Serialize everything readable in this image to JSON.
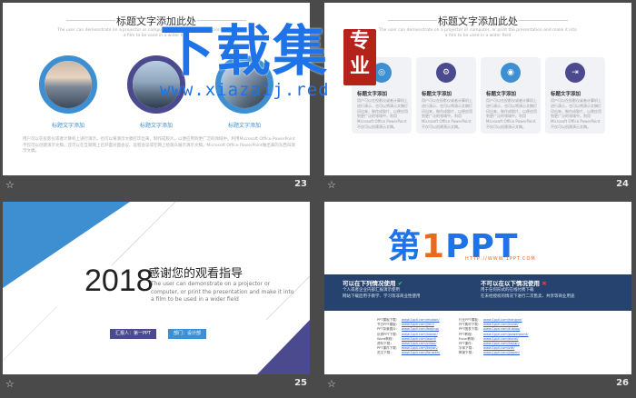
{
  "slides": [
    {
      "number": "23",
      "title": "标题文字添加此处",
      "subtitle": "The user can demonstrate on a projector or computer, or print the presentation and make it into a film to be used in a wider field",
      "captions": [
        "标题文字添加",
        "标题文字添加",
        "标题文字添加"
      ],
      "paragraph": "用户可以在投影仪或者计算机上进行演示，也可以将演示文稿打印出来，制作成胶片，以便应用到更广泛的领域中。利用Microsoft Office PowerPoint不仅可以创建演示文稿，还可以在互联网上召开面对面会议、远程会议或在网上给观众展示演示文稿。Microsoft Office PowerPoint做出来的东西叫演示文稿。"
    },
    {
      "number": "24",
      "title": "标题文字添加此处",
      "subtitle": "The user can demonstrate on a projector or computer, or print the presentation and make it into a film to be used in a wider field",
      "cards": [
        {
          "icon": "◎",
          "title": "标题文字添加",
          "body": "用户可以在投影仪或者计算机上进行演示，也可以将演示文稿打印出来，制作成胶片，以便应用到更广泛的领域中。利用Microsoft Office PowerPoint不仅可以创建演示文稿。"
        },
        {
          "icon": "⚙",
          "title": "标题文字添加",
          "body": "用户可以在投影仪或者计算机上进行演示，也可以将演示文稿打印出来，制作成胶片，以便应用到更广泛的领域中。利用Microsoft Office PowerPoint不仅可以创建演示文稿。"
        },
        {
          "icon": "◉",
          "title": "标题文字添加",
          "body": "用户可以在投影仪或者计算机上进行演示，也可以将演示文稿打印出来，制作成胶片，以便应用到更广泛的领域中。利用Microsoft Office PowerPoint不仅可以创建演示文稿。"
        },
        {
          "icon": "⇥",
          "title": "标题文字添加",
          "body": "用户可以在投影仪或者计算机上进行演示，也可以将演示文稿打印出来，制作成胶片，以便应用到更广泛的领域中。利用Microsoft Office PowerPoint不仅可以创建演示文稿。"
        }
      ]
    },
    {
      "number": "25",
      "year": "2018",
      "thanks": "感谢您的观看指导",
      "body": "The user can demonstrate on a projector or computer, or print the presentation and make it into a film to be used in a wider field",
      "pill_left": "汇报人：第一PPT",
      "pill_right": "部门：设计部"
    },
    {
      "number": "26",
      "logo_main": "第",
      "logo_one": "1",
      "logo_ppt": "PPT",
      "logo_url": "HTTP://WWW.1PPT.COM",
      "can_use_title": "可以在下列情况使用",
      "can_use_items": [
        "个人或者企业内部汇报演示使用",
        "网站下载后用于教学、学习等非商业性使用"
      ],
      "cannot_use_title": "不可以在以下情况使用",
      "cannot_use_items": [
        "用于任何形式的在线付费下载",
        "在未经授权的情况下进行二次售卖、共享等商业用途"
      ],
      "left_labels": [
        "PPT模板下载：",
        "节日PPT模板：",
        "PPT背景图片：",
        "优秀PPT下载：",
        "Word教程：",
        "资料下载：",
        "PPT课件下载：",
        "范文下载："
      ],
      "left_links": [
        "www.1ppt.com/moban/",
        "www.1ppt.com/jieri/",
        "www.1ppt.com/beijing/",
        "www.1ppt.com/xiazai/",
        "www.1ppt.com/word/",
        "www.1ppt.com/ziliao/",
        "www.1ppt.com/kejian/",
        "www.1ppt.com/fanwen/"
      ],
      "right_labels": [
        "行业PPT模板：",
        "PPT素材下载：",
        "PPT图表下载：",
        "PPT教程：",
        "Excel教程：",
        "PPT课件：",
        "字体下载：",
        "教案下载："
      ],
      "right_links": [
        "www.1ppt.com/hangye/",
        "www.1ppt.com/sucai/",
        "www.1ppt.com/tubiao/",
        "www.1ppt.com/powerpoint/",
        "www.1ppt.com/excel/",
        "www.1ppt.com/kejian/",
        "www.1ppt.com/ziti/",
        "www.1ppt.com/jiaoan/"
      ]
    }
  ],
  "watermark": {
    "big": "下载集",
    "seal": "专业",
    "url": "www.xiazaij.red"
  },
  "star_icon": "☆",
  "colors": {
    "blue": "#3d8fd1",
    "purple": "#4b4a8f",
    "navy": "#25436e",
    "orange": "#e96a1c"
  }
}
